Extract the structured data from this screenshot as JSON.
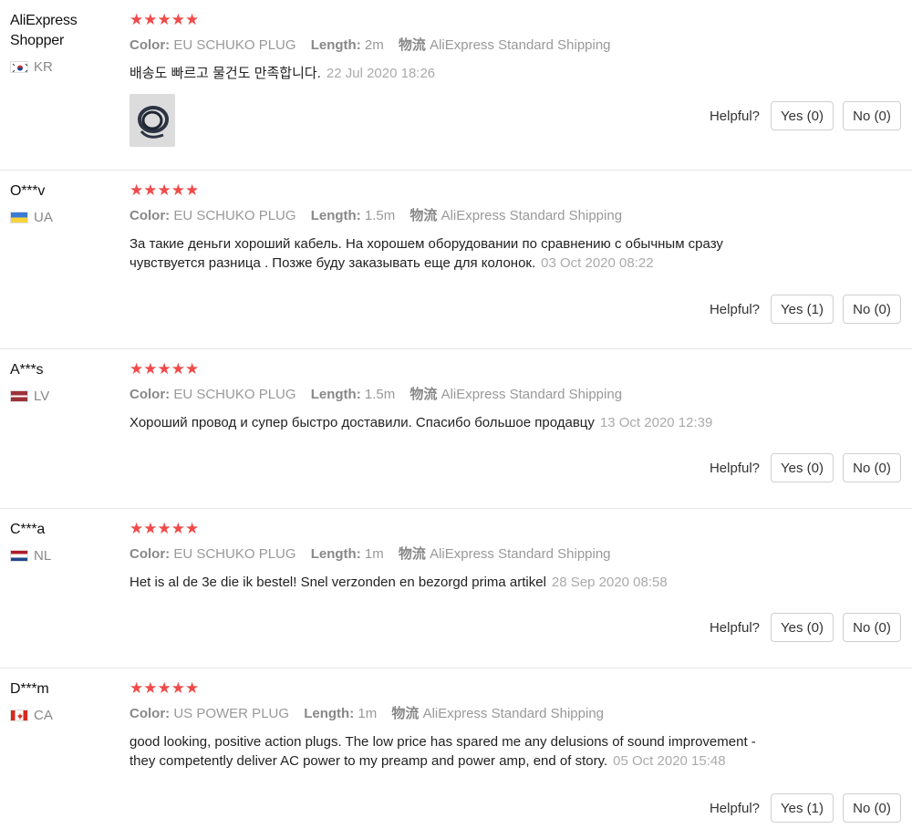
{
  "labels": {
    "color": "Color:",
    "length": "Length:",
    "shipping": "物流",
    "helpful": "Helpful?",
    "stars": "★★★★★"
  },
  "reviews": [
    {
      "user": "AliExpress Shopper",
      "country": "KR",
      "rating": 5,
      "color": "EU SCHUKO PLUG",
      "length": "2m",
      "shipping": "AliExpress Standard Shipping",
      "text": "배송도 빠르고 물건도 만족합니다.",
      "date": "22 Jul 2020 18:26",
      "has_photo": true,
      "yes": "Yes (0)",
      "no": "No (0)"
    },
    {
      "user": "O***v",
      "country": "UA",
      "rating": 5,
      "color": "EU SCHUKO PLUG",
      "length": "1.5m",
      "shipping": "AliExpress Standard Shipping",
      "text": "За такие деньги хороший кабель. На хорошем оборудовании по сравнению с обычным сразу чувствуется разница . Позже буду заказывать еще для колонок.",
      "date": "03 Oct 2020 08:22",
      "has_photo": false,
      "yes": "Yes (1)",
      "no": "No (0)"
    },
    {
      "user": "A***s",
      "country": "LV",
      "rating": 5,
      "color": "EU SCHUKO PLUG",
      "length": "1.5m",
      "shipping": "AliExpress Standard Shipping",
      "text": "Хороший провод и супер быстро доставили. Спасибо большое продавцу",
      "date": "13 Oct 2020 12:39",
      "has_photo": false,
      "yes": "Yes (0)",
      "no": "No (0)"
    },
    {
      "user": "C***a",
      "country": "NL",
      "rating": 5,
      "color": "EU SCHUKO PLUG",
      "length": "1m",
      "shipping": "AliExpress Standard Shipping",
      "text": "Het is al de 3e die ik bestel! Snel verzonden en bezorgd prima artikel",
      "date": "28 Sep 2020 08:58",
      "has_photo": false,
      "yes": "Yes (0)",
      "no": "No (0)"
    },
    {
      "user": "D***m",
      "country": "CA",
      "rating": 5,
      "color": "US POWER PLUG",
      "length": "1m",
      "shipping": "AliExpress Standard Shipping",
      "text": "good looking, positive action plugs. The low price has spared me any delusions of sound improvement - they competently deliver AC power to my preamp and power amp, end of story.",
      "date": "05 Oct 2020 15:48",
      "has_photo": false,
      "yes": "Yes (1)",
      "no": "No (0)"
    }
  ],
  "colors": {
    "star": "#f04a4a",
    "divider": "#e6e6e6",
    "muted": "#999999"
  }
}
